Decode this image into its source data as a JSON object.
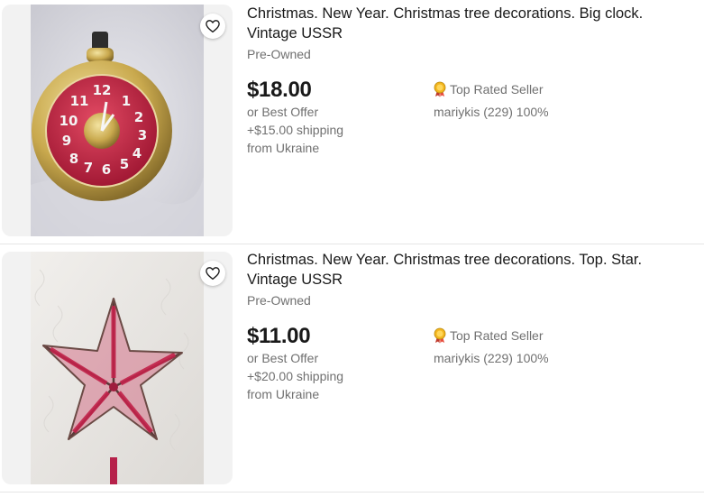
{
  "listings": [
    {
      "title": "Christmas. New Year. Christmas tree decorations. Big clock. Vintage USSR",
      "condition": "Pre-Owned",
      "price": "$18.00",
      "best_offer": "or Best Offer",
      "shipping": "+$15.00 shipping",
      "location": "from Ukraine",
      "seller_badge": "Top Rated Seller",
      "seller_info": "mariykis (229) 100%",
      "image": "vintage-clock-ornament-photo",
      "watch_icon": "heart-icon"
    },
    {
      "title": "Christmas. New Year. Christmas tree decorations. Top. Star. Vintage USSR",
      "condition": "Pre-Owned",
      "price": "$11.00",
      "best_offer": "or Best Offer",
      "shipping": "+$20.00 shipping",
      "location": "from Ukraine",
      "seller_badge": "Top Rated Seller",
      "seller_info": "mariykis (229) 100%",
      "image": "vintage-star-tree-topper-photo",
      "watch_icon": "heart-icon"
    }
  ]
}
